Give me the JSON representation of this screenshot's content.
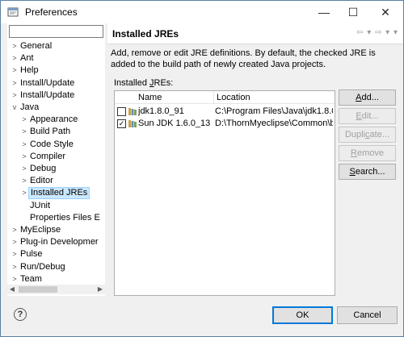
{
  "window": {
    "title": "Preferences",
    "minimize_glyph": "—",
    "maximize_glyph": "☐",
    "close_glyph": "✕"
  },
  "left": {
    "filter_value": "",
    "tree": [
      {
        "label": "General",
        "twisty": ">",
        "level": 0
      },
      {
        "label": "Ant",
        "twisty": ">",
        "level": 0
      },
      {
        "label": "Help",
        "twisty": ">",
        "level": 0
      },
      {
        "label": "Install/Update",
        "twisty": ">",
        "level": 0
      },
      {
        "label": "Install/Update",
        "twisty": ">",
        "level": 0
      },
      {
        "label": "Java",
        "twisty": "v",
        "level": 0
      },
      {
        "label": "Appearance",
        "twisty": ">",
        "level": 1
      },
      {
        "label": "Build Path",
        "twisty": ">",
        "level": 1
      },
      {
        "label": "Code Style",
        "twisty": ">",
        "level": 1
      },
      {
        "label": "Compiler",
        "twisty": ">",
        "level": 1
      },
      {
        "label": "Debug",
        "twisty": ">",
        "level": 1
      },
      {
        "label": "Editor",
        "twisty": ">",
        "level": 1
      },
      {
        "label": "Installed JREs",
        "twisty": ">",
        "level": 1,
        "selected": true
      },
      {
        "label": "JUnit",
        "twisty": "",
        "level": 1
      },
      {
        "label": "Properties Files E",
        "twisty": "",
        "level": 1
      },
      {
        "label": "MyEclipse",
        "twisty": ">",
        "level": 0
      },
      {
        "label": "Plug-in Developmer",
        "twisty": ">",
        "level": 0
      },
      {
        "label": "Pulse",
        "twisty": ">",
        "level": 0
      },
      {
        "label": "Run/Debug",
        "twisty": ">",
        "level": 0
      },
      {
        "label": "Team",
        "twisty": ">",
        "level": 0
      }
    ]
  },
  "page": {
    "title": "Installed JREs",
    "nav_glyphs": "⇦ ▾ ⇨ ▾ ▾",
    "description": "Add, remove or edit JRE definitions. By default, the checked JRE is added to the build path of newly created Java projects.",
    "installed_label_prefix": "Installed ",
    "installed_label_mnemonic": "J",
    "installed_label_suffix": "REs:",
    "columns": [
      "Name",
      "Location"
    ],
    "rows": [
      {
        "checked": false,
        "name": "jdk1.8.0_91",
        "location": "C:\\Program Files\\Java\\jdk1.8.0_"
      },
      {
        "checked": true,
        "name": "Sun JDK 1.6.0_13",
        "location": "D:\\ThornMyeclipse\\Common\\b"
      }
    ],
    "check_glyph": "✓"
  },
  "side_buttons": [
    {
      "pre": "",
      "mn": "A",
      "post": "dd...",
      "enabled": true
    },
    {
      "pre": "",
      "mn": "E",
      "post": "dit...",
      "enabled": false
    },
    {
      "pre": "Dupli",
      "mn": "c",
      "post": "ate...",
      "enabled": false
    },
    {
      "pre": "",
      "mn": "R",
      "post": "emove",
      "enabled": false
    },
    {
      "pre": "",
      "mn": "S",
      "post": "earch...",
      "enabled": true
    }
  ],
  "footer": {
    "help_glyph": "?",
    "ok_label": "OK",
    "cancel_label": "Cancel"
  }
}
